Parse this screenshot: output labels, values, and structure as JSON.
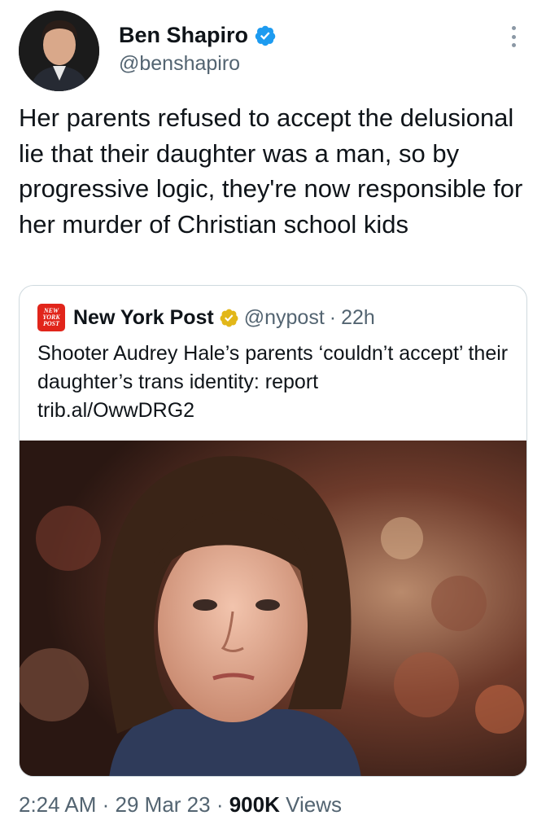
{
  "author": {
    "name": "Ben Shapiro",
    "handle": "@benshapiro",
    "avatar_icon": "person-avatar",
    "verified_color": "#1d9bf0"
  },
  "tweet": {
    "text": "Her parents refused to accept the delusional lie that their daughter was a man, so by progressive logic, they're now responsible for her murder of Christian school kids"
  },
  "quoted_tweet": {
    "logo_text": [
      "NEW",
      "YORK",
      "POST"
    ],
    "name": "New York Post",
    "handle": "@nypost",
    "separator": "·",
    "time": "22h",
    "text": "Shooter Audrey Hale’s parents ‘couldn’t accept’ their daughter’s trans identity: report",
    "link": "trib.al/OwwDRG2",
    "badge_color": "#e2b719",
    "logo_color": "#e1251b"
  },
  "footer": {
    "time": "2:24 AM",
    "sep1": " · ",
    "date": "29 Mar 23",
    "sep2": " · ",
    "views_count": "900K",
    "views_label": " Views"
  }
}
